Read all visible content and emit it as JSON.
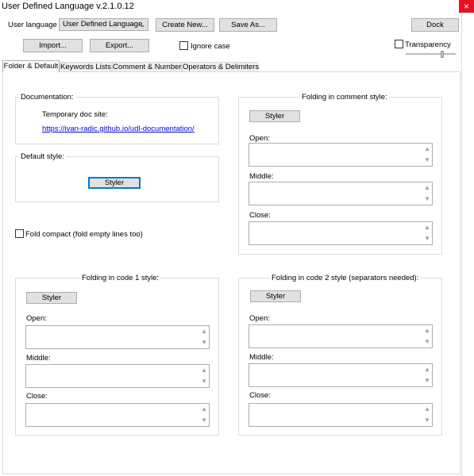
{
  "window": {
    "title": "User Defined Language v.2.1.0.12",
    "close_glyph": "×"
  },
  "toolbar": {
    "user_language_label": "User language :",
    "user_language_value": "User Defined Language",
    "create_new": "Create New...",
    "save_as": "Save As...",
    "dock": "Dock",
    "import": "Import...",
    "export": "Export...",
    "ignore_case": "Ignore case",
    "transparency": "Transparency"
  },
  "tabs": [
    {
      "label": "Folder & Default",
      "active": true
    },
    {
      "label": "Keywords Lists",
      "active": false
    },
    {
      "label": "Comment & Number",
      "active": false
    },
    {
      "label": "Operators & Delimiters",
      "active": false
    }
  ],
  "documentation": {
    "title": "Documentation:",
    "site_label": "Temporary doc site:",
    "link": "https://ivan-radic.github.io/udl-documentation/"
  },
  "default_style": {
    "title": "Default style:",
    "styler": "Styler"
  },
  "fold_compact": "Fold compact (fold empty lines too)",
  "groups": {
    "comment": {
      "title": "Folding in comment style:",
      "styler": "Styler",
      "open": "Open:",
      "middle": "Middle:",
      "close": "Close:"
    },
    "code1": {
      "title": "Folding in code 1 style:",
      "styler": "Styler",
      "open": "Open:",
      "middle": "Middle:",
      "close": "Close:"
    },
    "code2": {
      "title": "Folding in code 2 style (separators needed):",
      "styler": "Styler",
      "open": "Open:",
      "middle": "Middle:",
      "close": "Close:"
    }
  },
  "icons": {
    "dropdown": "chevron-down-icon",
    "scroll_up": "▲",
    "scroll_down": "▼",
    "combo_arrow": "⌄"
  }
}
